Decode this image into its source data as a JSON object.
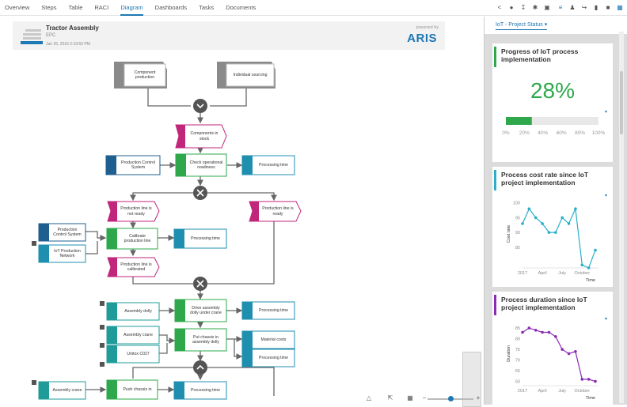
{
  "tabs": [
    "Overview",
    "Steps",
    "Table",
    "RACI",
    "Diagram",
    "Dashboards",
    "Tasks",
    "Documents"
  ],
  "active_tab": "Diagram",
  "header": {
    "title": "Tractor Assembly",
    "type": "EPC",
    "date": "Jan 26, 2016 2:19:50 PM",
    "powered": "powered by",
    "brand": "ARIS"
  },
  "panel": {
    "dropdown": "IoT - Project Status",
    "card1": {
      "title": "Progress of IoT process implementation",
      "value": "28%",
      "progress": 0.28,
      "ticks": [
        "0%",
        "20%",
        "40%",
        "60%",
        "80%",
        "100%"
      ]
    },
    "card2": {
      "title": "Process cost rate since IoT project implementation",
      "ylabel": "Cost rate",
      "xlabel": "Time",
      "yticks": [
        "100",
        "95",
        "90",
        "85"
      ],
      "xticks": [
        "2017",
        "April",
        "July",
        "October"
      ]
    },
    "card3": {
      "title": "Process duration since IoT project implementation",
      "ylabel": "Duration",
      "xlabel": "Time",
      "yticks": [
        "85",
        "80",
        "75",
        "70",
        "65",
        "60"
      ],
      "xticks": [
        "2017",
        "April",
        "July",
        "October"
      ]
    }
  },
  "colors": {
    "accent": "#1e78b4",
    "green": "#2ea84b",
    "magenta": "#c0267a",
    "teal": "#1f8fb0",
    "purple": "#8a2bb5",
    "cyan": "#27b0c8"
  },
  "nodes": {
    "component_production": "Component production",
    "individual_sourcing": "Individual sourcing",
    "components_in_stock": "Components in stock",
    "production_control_system_1": "Production Control System",
    "check_operational_readiness": "Check operational readiness",
    "processing_time_1": "Processing time",
    "production_line_not_ready": "Production line is not ready",
    "production_line_ready": "Production line is ready",
    "production_control_system_2": "Production Control System",
    "iot_production_network": "IoT Production Network",
    "calibrate_production_line": "Calibrate production line",
    "processing_time_2": "Processing time",
    "production_line_calibrated": "Production line is calibrated",
    "assembly_dolly": "Assembly dolly",
    "drive_assembly_dolly": "Drive assembly dolly under crane",
    "processing_time_3": "Processing time",
    "assembly_crane_1": "Assembly crane",
    "unitox": "Unitox C027",
    "put_chassis": "Put chassis in assembly dolly",
    "material_costs": "Material costs",
    "processing_time_4": "Processing time",
    "assembly_crane_2": "Assembly crane",
    "push_chassis": "Push chassis in",
    "processing_time_5": "Processing time"
  },
  "chart_data": [
    {
      "type": "bar",
      "title": "Progress of IoT process implementation",
      "values": [
        28
      ],
      "xlim": [
        0,
        100
      ]
    },
    {
      "type": "line",
      "title": "Process cost rate since IoT project implementation",
      "x": [
        "2017-01",
        "2017-02",
        "2017-03",
        "2017-04",
        "2017-05",
        "2017-06",
        "2017-07",
        "2017-08",
        "2017-09",
        "2017-10",
        "2017-11",
        "2017-12"
      ],
      "values": [
        93,
        98,
        95,
        93,
        90,
        90,
        95,
        93,
        98,
        79,
        78,
        84
      ],
      "xlabel": "Time",
      "ylabel": "Cost rate",
      "ylim": [
        78,
        101
      ]
    },
    {
      "type": "line",
      "title": "Process duration since IoT project implementation",
      "x": [
        "2017-01",
        "2017-02",
        "2017-03",
        "2017-04",
        "2017-05",
        "2017-06",
        "2017-07",
        "2017-08",
        "2017-09",
        "2017-10",
        "2017-11",
        "2017-12"
      ],
      "values": [
        83,
        85,
        84,
        83,
        83,
        81,
        75,
        73,
        74,
        61,
        61,
        60
      ],
      "xlabel": "Time",
      "ylabel": "Duration",
      "ylim": [
        58,
        88
      ]
    }
  ]
}
